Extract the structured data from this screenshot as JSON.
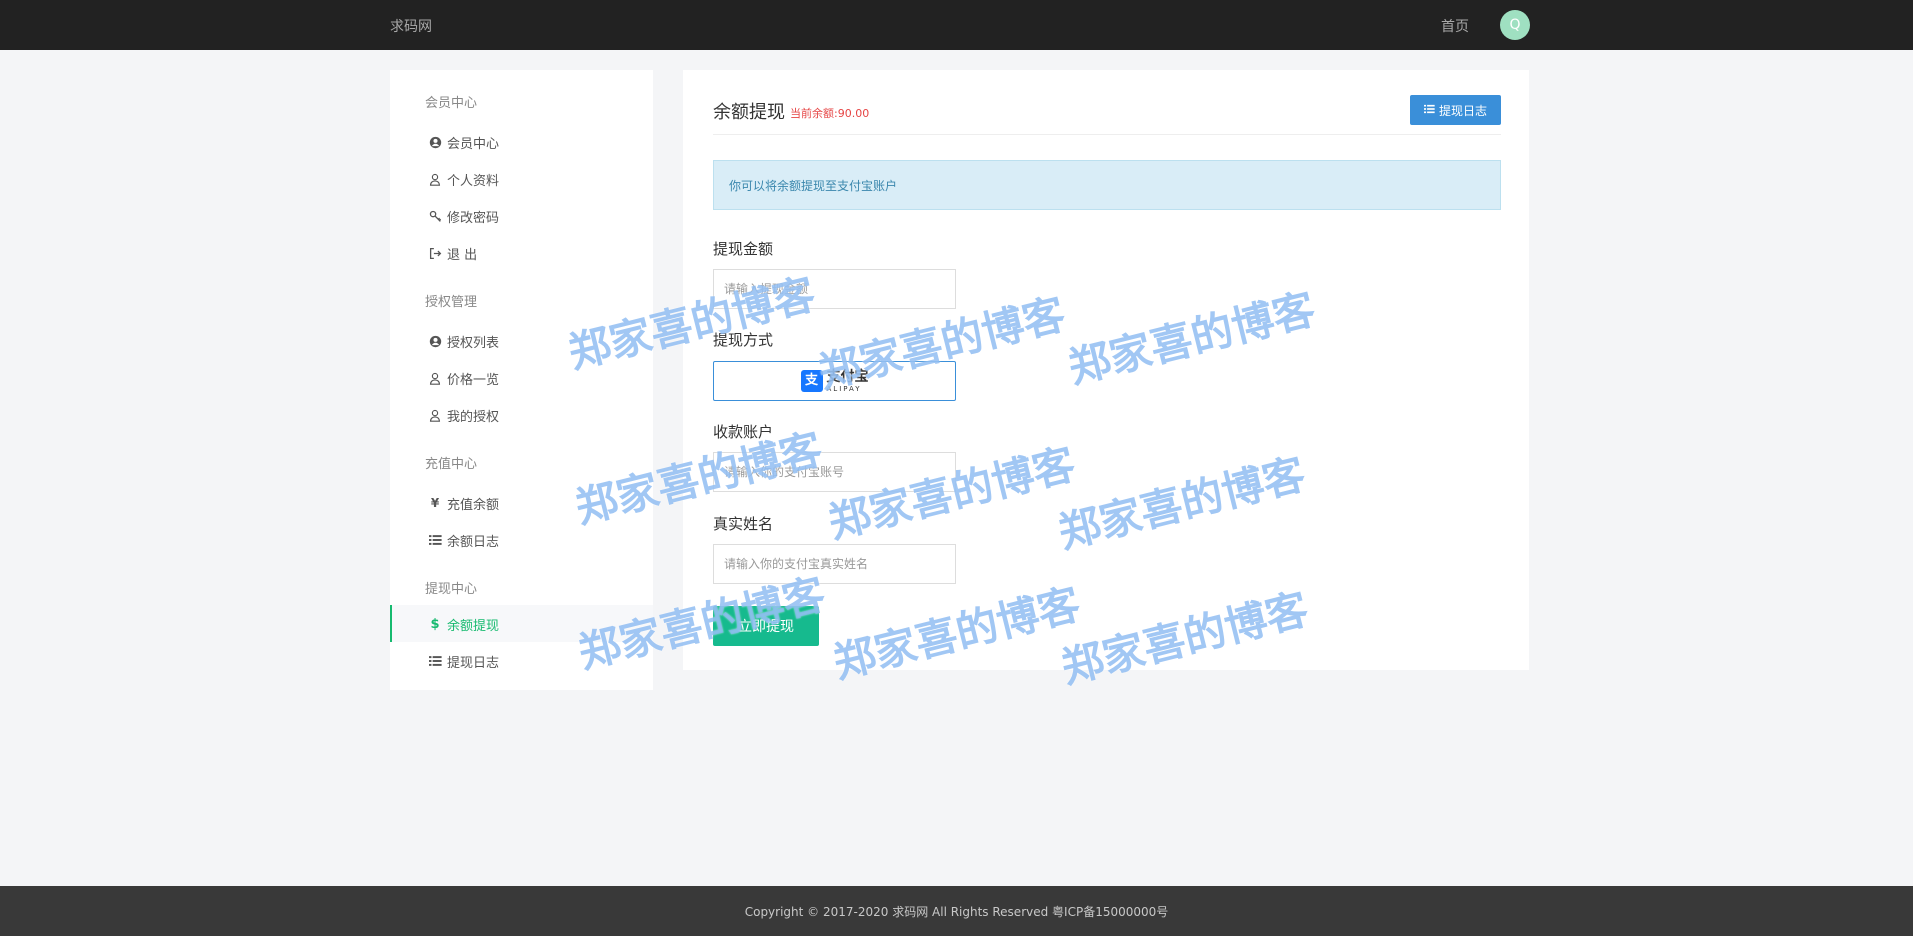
{
  "topnav": {
    "brand": "求码网",
    "home": "首页",
    "avatar_letter": "Q"
  },
  "sidebar": {
    "groups": [
      {
        "title": "会员中心",
        "items": [
          {
            "label": "会员中心",
            "icon": "user-circle-icon"
          },
          {
            "label": "个人资料",
            "icon": "user-icon"
          },
          {
            "label": "修改密码",
            "icon": "key-icon"
          },
          {
            "label": "退 出",
            "icon": "sign-out-icon"
          }
        ]
      },
      {
        "title": "授权管理",
        "items": [
          {
            "label": "授权列表",
            "icon": "user-circle-icon"
          },
          {
            "label": "价格一览",
            "icon": "user-icon"
          },
          {
            "label": "我的授权",
            "icon": "user-icon"
          }
        ]
      },
      {
        "title": "充值中心",
        "items": [
          {
            "label": "充值余额",
            "icon": "yen-icon"
          },
          {
            "label": "余额日志",
            "icon": "list-icon"
          }
        ]
      },
      {
        "title": "提现中心",
        "items": [
          {
            "label": "余额提现",
            "icon": "dollar-icon",
            "active": true
          },
          {
            "label": "提现日志",
            "icon": "list-icon"
          }
        ]
      }
    ]
  },
  "main": {
    "title": "余额提现",
    "balance": "当前余额:90.00",
    "log_button": "提现日志",
    "alert": "你可以将余额提现至支付宝账户",
    "amount_label": "提现金额",
    "amount_placeholder": "请输入提现金额",
    "method_label": "提现方式",
    "method_name_cn": "支付宝",
    "method_name_en": "ALIPAY",
    "account_label": "收款账户",
    "account_placeholder": "请输入你的支付宝账号",
    "name_label": "真实姓名",
    "name_placeholder": "请输入你的支付宝真实姓名",
    "submit": "立即提现"
  },
  "watermark": "郑家喜的博客",
  "footer": "Copyright © 2017-2020 求码网 All Rights Reserved 粤ICP备15000000号",
  "colors": {
    "accent_green": "#16ba8e",
    "primary_blue": "#3a8fd9",
    "danger_red": "#e64545"
  }
}
